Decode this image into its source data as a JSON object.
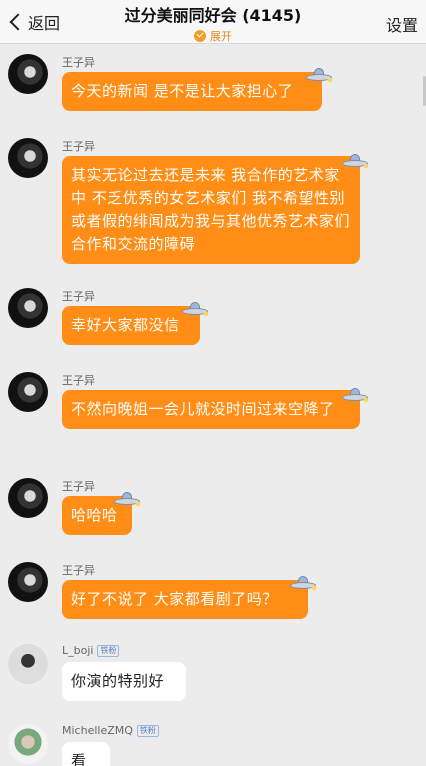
{
  "header": {
    "back_label": "返回",
    "title": "过分美丽同好会 (4145)",
    "expand_label": "展开",
    "settings_label": "设置"
  },
  "messages": [
    {
      "sender": "王子异",
      "text": "今天的新闻 是不是让大家担心了"
    },
    {
      "sender": "王子异",
      "text": "其实无论过去还是未来 我合作的艺术家中 不乏优秀的女艺术家们 我不希望性别或者假的绯闻成为我与其他优秀艺术家们合作和交流的障碍"
    },
    {
      "sender": "王子异",
      "text": "幸好大家都没信"
    },
    {
      "sender": "王子异",
      "text": "不然向晚姐一会儿就没时间过来空降了"
    },
    {
      "sender": "王子异",
      "text": "哈哈哈"
    },
    {
      "sender": "王子异",
      "text": "好了不说了 大家都看剧了吗？"
    },
    {
      "sender": "L_boji",
      "badge": "铁粉",
      "text": "你演的特别好"
    },
    {
      "sender": "MichelleZMQ",
      "badge": "铁粉",
      "text": "看了"
    }
  ],
  "icons": {
    "back": "chevron-left-icon",
    "expand": "check-circle-icon",
    "bubble_decor": "ufo-sticker-icon"
  },
  "colors": {
    "bubble_orange": "#ff8d16",
    "bubble_white": "#ffffff",
    "accent": "#e08a1e"
  }
}
